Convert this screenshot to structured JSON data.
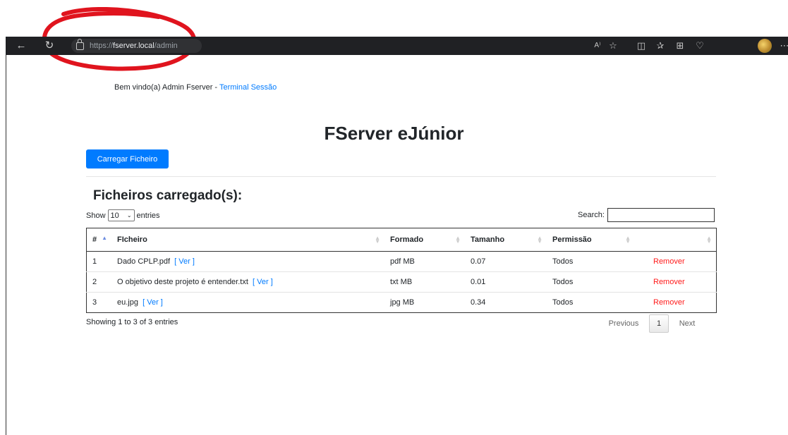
{
  "browser": {
    "url_scheme": "https://",
    "url_host": "fserver.local",
    "url_path": "/admin",
    "read_aloud_label": "A⁾"
  },
  "header": {
    "welcome_text": "Bem vindo(a) Admin Fserver - ",
    "logout_link": "Terminal Sessão"
  },
  "main": {
    "title": "FServer eJúnior",
    "upload_button": "Carregar Ficheiro",
    "section_title": "Ficheiros carregado(s):",
    "length_prefix": "Show",
    "length_value": "10",
    "length_suffix": "entries",
    "search_label": "Search:",
    "search_value": ""
  },
  "table": {
    "columns": [
      "#",
      "FIcheiro",
      "Formado",
      "Tamanho",
      "Permissão",
      ""
    ],
    "rows": [
      {
        "num": "1",
        "file": "Dado CPLP.pdf",
        "view": "[ Ver ]",
        "format": "pdf MB",
        "size": "0.07",
        "permission": "Todos",
        "action": "Remover"
      },
      {
        "num": "2",
        "file": "O objetivo deste projeto é entender.txt",
        "view": "[ Ver ]",
        "format": "txt MB",
        "size": "0.01",
        "permission": "Todos",
        "action": "Remover"
      },
      {
        "num": "3",
        "file": "eu.jpg",
        "view": "[ Ver ]",
        "format": "jpg MB",
        "size": "0.34",
        "permission": "Todos",
        "action": "Remover"
      }
    ]
  },
  "footer": {
    "info": "Showing 1 to 3 of 3 entries",
    "previous": "Previous",
    "current_page": "1",
    "next": "Next"
  },
  "colors": {
    "primary": "#007bff",
    "danger": "#ff1a1a",
    "annotation": "#e0141e"
  }
}
